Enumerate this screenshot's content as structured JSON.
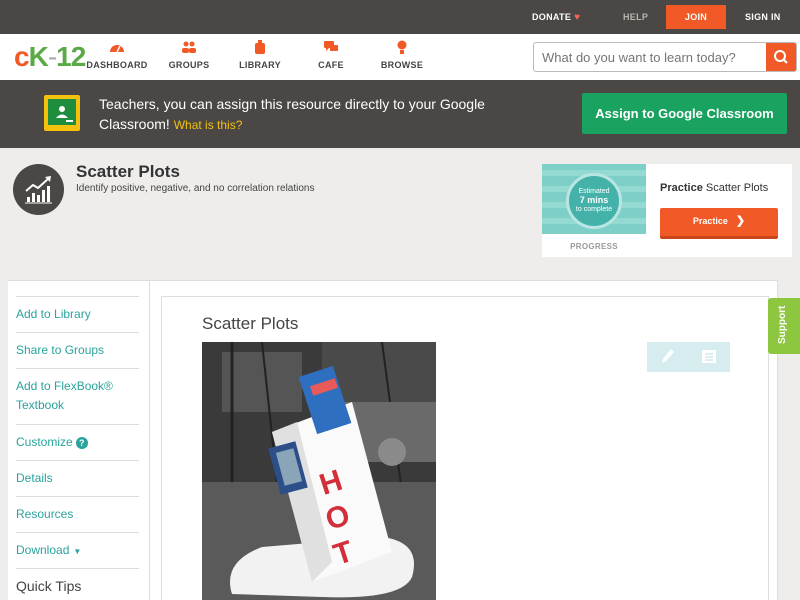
{
  "topbar": {
    "donate": "DONATE",
    "help": "HELP",
    "join": "JOIN",
    "signin": "SIGN IN"
  },
  "header": {
    "logo": {
      "c": "c",
      "k": "K",
      "dash": "-",
      "num": "12"
    },
    "nav": [
      {
        "label": "DASHBOARD",
        "icon": "dashboard-icon"
      },
      {
        "label": "GROUPS",
        "icon": "groups-icon"
      },
      {
        "label": "LIBRARY",
        "icon": "library-icon"
      },
      {
        "label": "CAFE",
        "icon": "cafe-icon"
      },
      {
        "label": "BROWSE",
        "icon": "browse-icon"
      }
    ],
    "search": {
      "placeholder": "What do you want to learn today?"
    }
  },
  "banner": {
    "text": "Teachers, you can assign this resource directly to your Google Classroom!",
    "link": "What is this?",
    "button": "Assign to Google Classroom"
  },
  "concept": {
    "title": "Scatter Plots",
    "subtitle": "Identify positive, negative, and no correlation relations"
  },
  "practice": {
    "estimated": "Estimated",
    "mins": "7 mins",
    "complete": "to complete",
    "progress": "PROGRESS",
    "title_bold": "Practice",
    "title_rest": "Scatter Plots",
    "button": "Practice"
  },
  "sidebar": {
    "items": [
      {
        "label": "Add to Library"
      },
      {
        "label": "Share to Groups"
      },
      {
        "label": "Add to FlexBook® Textbook"
      },
      {
        "label": "Customize"
      },
      {
        "label": "Details"
      },
      {
        "label": "Resources"
      },
      {
        "label": "Download"
      },
      {
        "label": "Quick Tips"
      }
    ]
  },
  "content": {
    "title": "Scatter Plots"
  },
  "support": "Support",
  "colors": {
    "brand_orange": "#f15a26",
    "brand_green": "#5aaa47",
    "teal_link": "#2aa39b",
    "google_green": "#1aa260",
    "dark_bar": "#4a4745"
  }
}
